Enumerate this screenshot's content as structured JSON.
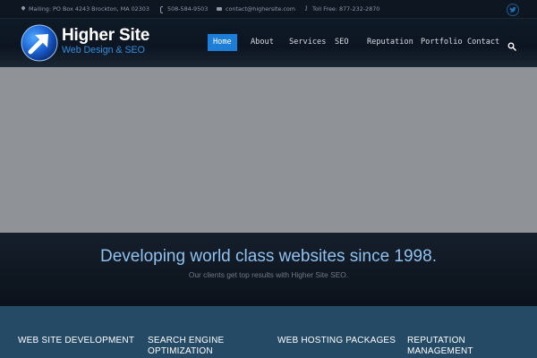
{
  "topbar": {
    "address": "Mailing: PO Box 4243 Brockton, MA 02303",
    "phone": "508-584-9503",
    "email": "contact@highersite.com",
    "tollfree": "Toll Free: 877-232-2870",
    "social_icon": "twitter-icon"
  },
  "logo": {
    "title": "Higher Site",
    "subtitle": "Web Design & SEO"
  },
  "nav": {
    "items": [
      "Home",
      "About",
      "Services",
      "SEO",
      "Reputation",
      "Portfolio",
      "Contact"
    ],
    "active": "Home",
    "search_icon": "search-icon"
  },
  "hero": {},
  "tagline": {
    "title": "Developing world class websites since 1998.",
    "subtitle": "Our clients get top results with Higher Site SEO."
  },
  "services": [
    {
      "line1": "WEB SITE DEVELOPMENT",
      "line2": ""
    },
    {
      "line1": "SEARCH ENGINE",
      "line2": "OPTIMIZATION"
    },
    {
      "line1": "WEB HOSTING PACKAGES",
      "line2": ""
    },
    {
      "line1": "REPUTATION",
      "line2": "MANAGEMENT"
    }
  ],
  "colors": {
    "accent": "#1c7ed6",
    "tagline": "#8fc2f0",
    "services_bg": "#254a66",
    "hero_bg": "#8f9397"
  }
}
